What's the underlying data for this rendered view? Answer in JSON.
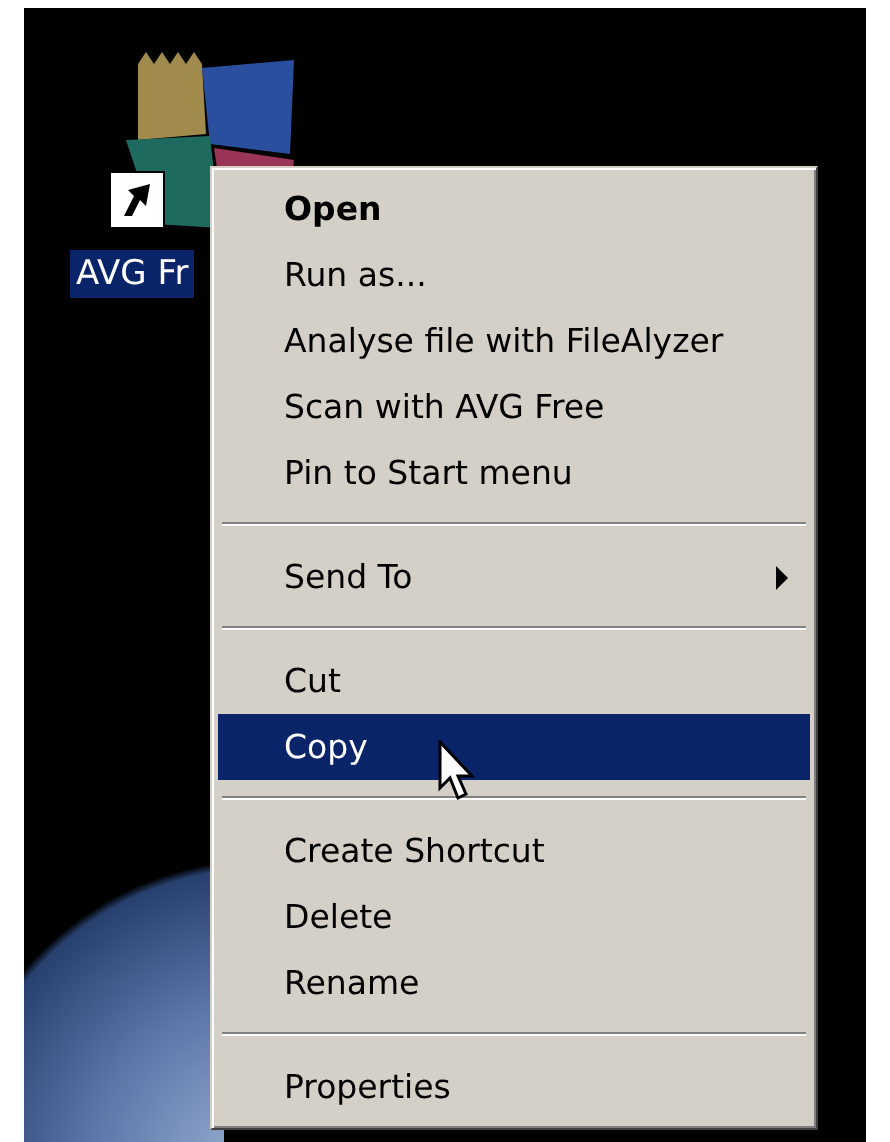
{
  "desktop_icon": {
    "label": "AVG Fr",
    "selected": true
  },
  "context_menu": {
    "items": [
      {
        "kind": "item",
        "label": "Open",
        "default": true,
        "selected": false,
        "submenu": false
      },
      {
        "kind": "item",
        "label": "Run as...",
        "default": false,
        "selected": false,
        "submenu": false
      },
      {
        "kind": "item",
        "label": "Analyse file with FileAlyzer",
        "default": false,
        "selected": false,
        "submenu": false
      },
      {
        "kind": "item",
        "label": "Scan with AVG Free",
        "default": false,
        "selected": false,
        "submenu": false
      },
      {
        "kind": "item",
        "label": "Pin to Start menu",
        "default": false,
        "selected": false,
        "submenu": false
      },
      {
        "kind": "separator"
      },
      {
        "kind": "item",
        "label": "Send To",
        "default": false,
        "selected": false,
        "submenu": true
      },
      {
        "kind": "separator"
      },
      {
        "kind": "item",
        "label": "Cut",
        "default": false,
        "selected": false,
        "submenu": false
      },
      {
        "kind": "item",
        "label": "Copy",
        "default": false,
        "selected": true,
        "submenu": false
      },
      {
        "kind": "separator"
      },
      {
        "kind": "item",
        "label": "Create Shortcut",
        "default": false,
        "selected": false,
        "submenu": false
      },
      {
        "kind": "item",
        "label": "Delete",
        "default": false,
        "selected": false,
        "submenu": false
      },
      {
        "kind": "item",
        "label": "Rename",
        "default": false,
        "selected": false,
        "submenu": false
      },
      {
        "kind": "separator"
      },
      {
        "kind": "item",
        "label": "Properties",
        "default": false,
        "selected": false,
        "submenu": false
      }
    ]
  }
}
